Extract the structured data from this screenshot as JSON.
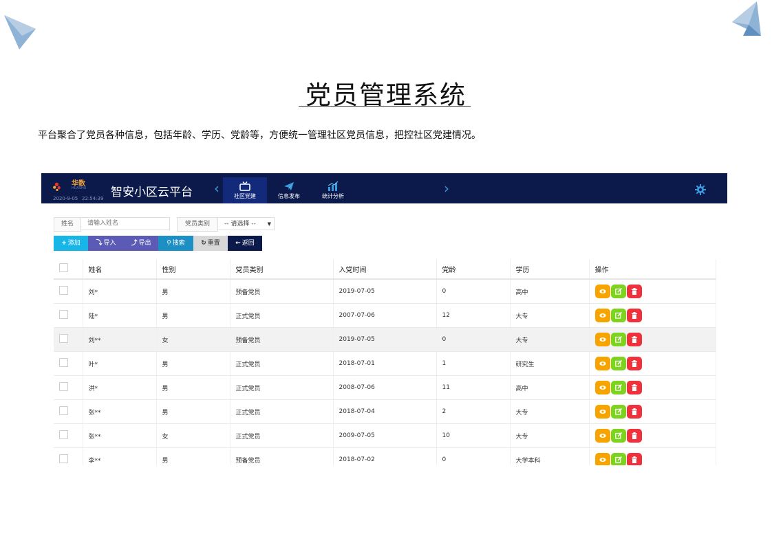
{
  "page": {
    "title": "党员管理系统",
    "intro": "平台聚合了党员各种信息，包括年龄、学历、党龄等，方便统一管理社区党员信息，把控社区党建情况。"
  },
  "navbar": {
    "logo_text": "华数",
    "logo_subtext": "HUASHU",
    "date": "2020-9-05",
    "time": "22:54:39",
    "app_name": "智安小区云平台",
    "tabs": [
      {
        "label": "社区党建",
        "icon": "tv-icon",
        "active": true
      },
      {
        "label": "信息发布",
        "icon": "send-icon",
        "active": false
      },
      {
        "label": "统计分析",
        "icon": "bar-chart-icon",
        "active": false
      }
    ],
    "colors": {
      "background": "#0b1a4a",
      "active_tab": "#13297a",
      "accent": "#3a9be0"
    }
  },
  "search": {
    "name_label": "姓名",
    "name_placeholder": "请输入姓名",
    "type_label": "党员类别",
    "type_selected": "-- 请选择 --"
  },
  "toolbar": {
    "add": "添加",
    "import": "导入",
    "export": "导出",
    "search": "搜索",
    "reset": "重置",
    "back": "返回",
    "colors": {
      "add": "#17b6e6",
      "import": "#5b5bb6",
      "export": "#5b5bb6",
      "search": "#1c8fc4",
      "reset": "#d8d8d8",
      "back": "#0b1a4a"
    }
  },
  "table": {
    "headers": [
      "姓名",
      "性别",
      "党员类别",
      "入党时间",
      "党龄",
      "学历",
      "操作"
    ],
    "rows": [
      [
        "刘*",
        "男",
        "预备党员",
        "2019-07-05",
        "0",
        "高中"
      ],
      [
        "陆*",
        "男",
        "正式党员",
        "2007-07-06",
        "12",
        "大专"
      ],
      [
        "刘**",
        "女",
        "预备党员",
        "2019-07-05",
        "0",
        "大专"
      ],
      [
        "叶*",
        "男",
        "正式党员",
        "2018-07-01",
        "1",
        "研究生"
      ],
      [
        "洪*",
        "男",
        "正式党员",
        "2008-07-06",
        "11",
        "高中"
      ],
      [
        "张**",
        "男",
        "正式党员",
        "2018-07-04",
        "2",
        "大专"
      ],
      [
        "张**",
        "女",
        "正式党员",
        "2009-07-05",
        "10",
        "大专"
      ],
      [
        "李**",
        "男",
        "预备党员",
        "2018-07-02",
        "0",
        "大学本科"
      ]
    ],
    "row_actions": [
      "eye-icon",
      "edit-icon",
      "trash-icon"
    ],
    "action_colors": {
      "view": "#f7a400",
      "edit": "#7ed321",
      "delete": "#f0313c"
    }
  }
}
